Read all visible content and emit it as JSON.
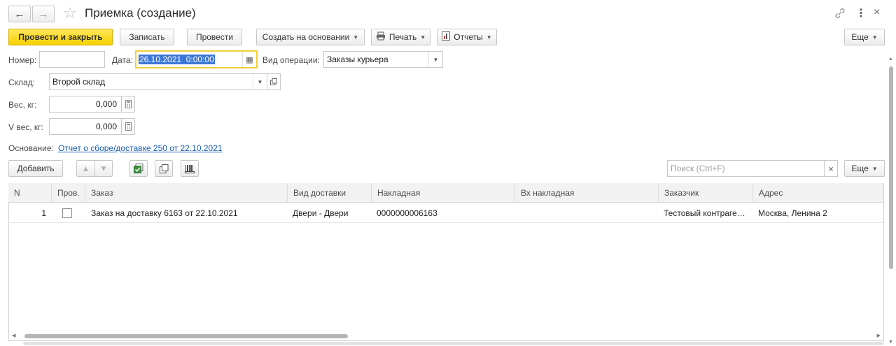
{
  "window": {
    "title": "Приемка (создание)"
  },
  "toolbar": {
    "post_close": "Провести и закрыть",
    "save": "Записать",
    "post": "Провести",
    "create_based": "Создать на основании",
    "print": "Печать",
    "reports": "Отчеты",
    "more": "Еще"
  },
  "form": {
    "number_label": "Номер:",
    "number_value": "",
    "date_label": "Дата:",
    "date_value": "26.10.2021  0:00:00",
    "operation_label": "Вид операции:",
    "operation_value": "Заказы курьера",
    "warehouse_label": "Склад:",
    "warehouse_value": "Второй склад",
    "weight_label": "Вес, кг:",
    "weight_value": "0,000",
    "vweight_label": "V вес, кг:",
    "vweight_value": "0,000",
    "basis_label": "Основание:",
    "basis_link": "Отчет о сборе/доставке 250 от 22.10.2021"
  },
  "table_toolbar": {
    "add": "Добавить",
    "search_placeholder": "Поиск (Ctrl+F)",
    "more": "Еще"
  },
  "table": {
    "columns": [
      "N",
      "Пров.",
      "Заказ",
      "Вид доставки",
      "Накладная",
      "Вх накладная",
      "Заказчик",
      "Адрес"
    ],
    "rows": [
      {
        "n": "1",
        "checked": false,
        "order": "Заказ на доставку 6163 от 22.10.2021",
        "delivery": "Двери - Двери",
        "waybill": "0000000006163",
        "in_waybill": "",
        "customer": "Тестовый контраге…",
        "address": "Москва, Ленина 2"
      }
    ]
  }
}
